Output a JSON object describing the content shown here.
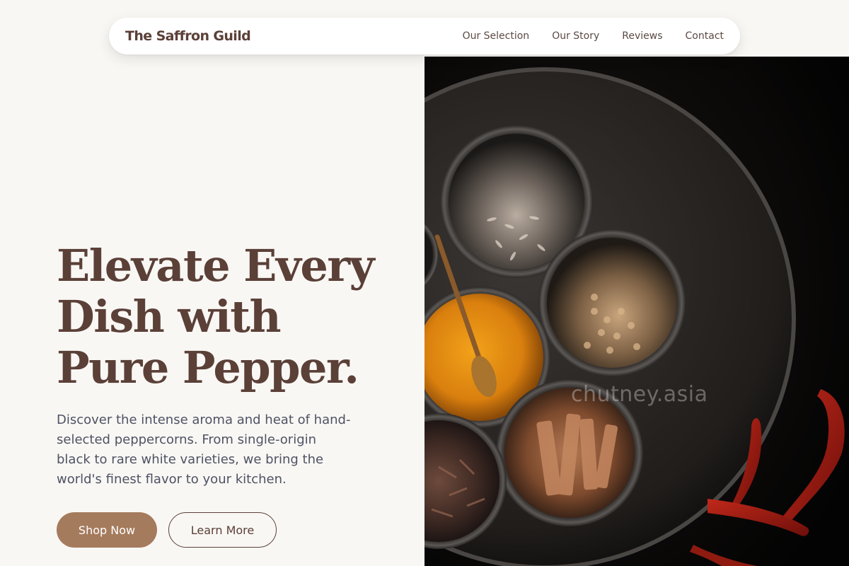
{
  "nav": {
    "brand": "The Saffron Guild",
    "links": [
      {
        "label": "Our Selection"
      },
      {
        "label": "Our Story"
      },
      {
        "label": "Reviews"
      },
      {
        "label": "Contact"
      }
    ]
  },
  "hero": {
    "headline_lines": [
      "Elevate Every",
      "Dish with",
      "Pure Pepper."
    ],
    "description_lines": [
      "Discover the intense aroma and heat of hand-",
      "selected peppercorns. From single-origin",
      "black to rare white varieties, we bring the",
      "world's finest flavor to your kitchen."
    ],
    "primary_button": "Shop Now",
    "secondary_button": "Learn More"
  },
  "image": {
    "watermark": "chutney.asia",
    "icon": "spice-tray-photo"
  },
  "colors": {
    "brand_brown": "#5b4038",
    "accent_tan": "#a57b5d",
    "background": "#f9f7f4",
    "body_text": "#4e5263"
  }
}
